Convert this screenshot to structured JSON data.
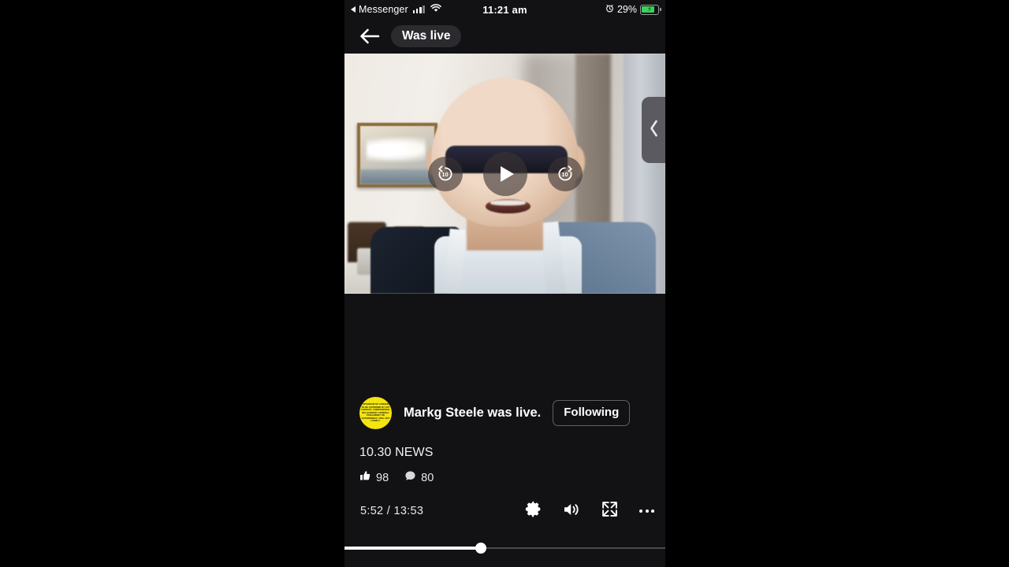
{
  "status_bar": {
    "back_app": "Messenger",
    "time": "11:21 am",
    "battery_percent": "29%",
    "icons": [
      "back-triangle-icon",
      "signal-bars-icon",
      "wifi-icon",
      "alarm-clock-icon",
      "battery-charging-icon"
    ]
  },
  "nav": {
    "back_icon": "back-arrow-icon",
    "pill_label": "Was live"
  },
  "video": {
    "rewind_label": "10",
    "forward_label": "10",
    "play_icon": "play-icon",
    "rewind_icon": "rewind-10-icon",
    "forward_icon": "forward-10-icon",
    "drawer_icon": "chevron-left-icon"
  },
  "post": {
    "avatar_text": "I WITHDRAW MY CONSENT TO BE GOVERNED BY ANY CORRUPT, COMPROMISED, BELLIGERENT, CRIMINAL PARLIAMENT OR GOVERNMENT. I WILL NOT COMPLY.",
    "author_line": "Markg Steele was live.",
    "follow_label": "Following",
    "caption": "10.30 NEWS",
    "like_icon": "thumbs-up-icon",
    "like_count": "98",
    "comment_icon": "comment-bubble-icon",
    "comment_count": "80"
  },
  "player": {
    "current_time": "5:52",
    "separator": "/",
    "duration": "13:53",
    "settings_icon": "gear-icon",
    "volume_icon": "volume-on-icon",
    "fullscreen_icon": "fullscreen-expand-icon",
    "more_icon": "more-options-icon",
    "progress_percent": 42.5
  },
  "colors": {
    "screen_bg": "#121214",
    "pill_bg": "#2b2b2f",
    "avatar_yellow": "#f4e410",
    "battery_green": "#3ad15b",
    "letterbox": "#000000"
  }
}
